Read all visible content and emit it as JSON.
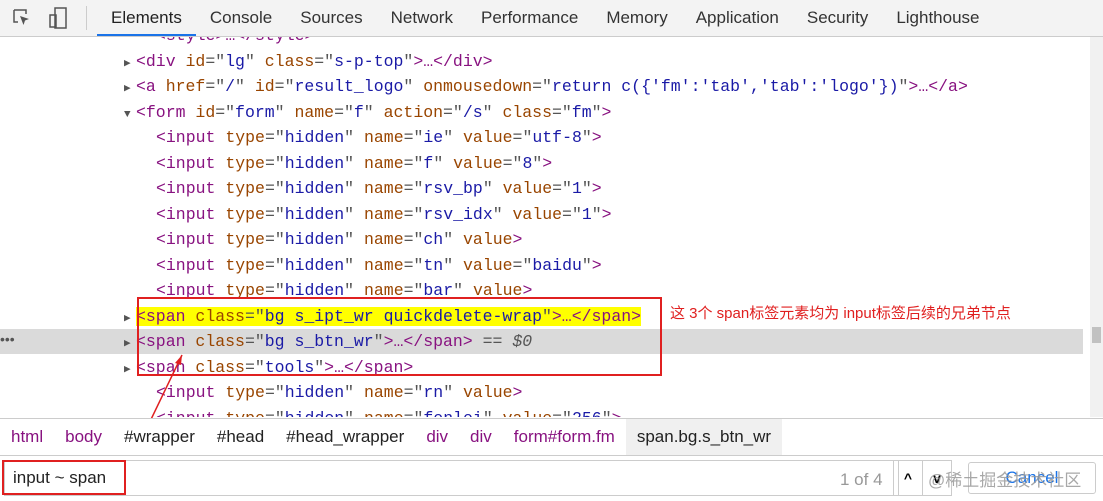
{
  "toolbar": {
    "tabs": [
      "Elements",
      "Console",
      "Sources",
      "Network",
      "Performance",
      "Memory",
      "Application",
      "Security",
      "Lighthouse"
    ],
    "active": "Elements"
  },
  "code_lines": [
    {
      "indent": 14,
      "tri": "",
      "tokens": [
        [
          "p",
          "<"
        ],
        [
          "t",
          "style"
        ],
        [
          "p",
          ">…</"
        ],
        [
          "t",
          "style"
        ],
        [
          "p",
          ">"
        ]
      ]
    },
    {
      "indent": 12,
      "tri": "▶",
      "tokens": [
        [
          "p",
          "<"
        ],
        [
          "t",
          "div "
        ],
        [
          "an",
          "id"
        ],
        [
          "eq",
          "=\""
        ],
        [
          "av",
          "lg"
        ],
        [
          "eq",
          "\" "
        ],
        [
          "an",
          "class"
        ],
        [
          "eq",
          "=\""
        ],
        [
          "av",
          "s-p-top"
        ],
        [
          "eq",
          "\""
        ],
        [
          "p",
          ">…</"
        ],
        [
          "t",
          "div"
        ],
        [
          "p",
          ">"
        ]
      ]
    },
    {
      "indent": 12,
      "tri": "▶",
      "tokens": [
        [
          "p",
          "<"
        ],
        [
          "t",
          "a "
        ],
        [
          "an",
          "href"
        ],
        [
          "eq",
          "=\""
        ],
        [
          "av",
          "/"
        ],
        [
          "eq",
          "\" "
        ],
        [
          "an",
          "id"
        ],
        [
          "eq",
          "=\""
        ],
        [
          "av",
          "result_logo"
        ],
        [
          "eq",
          "\" "
        ],
        [
          "an",
          "onmousedown"
        ],
        [
          "eq",
          "=\""
        ],
        [
          "av",
          "return c({'fm':'tab','tab':'logo'})"
        ],
        [
          "eq",
          "\""
        ],
        [
          "p",
          ">…</"
        ],
        [
          "t",
          "a"
        ],
        [
          "p",
          ">"
        ]
      ]
    },
    {
      "indent": 12,
      "tri": "▼",
      "tokens": [
        [
          "p",
          "<"
        ],
        [
          "t",
          "form "
        ],
        [
          "an",
          "id"
        ],
        [
          "eq",
          "=\""
        ],
        [
          "av",
          "form"
        ],
        [
          "eq",
          "\" "
        ],
        [
          "an",
          "name"
        ],
        [
          "eq",
          "=\""
        ],
        [
          "av",
          "f"
        ],
        [
          "eq",
          "\" "
        ],
        [
          "an",
          "action"
        ],
        [
          "eq",
          "=\""
        ],
        [
          "av",
          "/s"
        ],
        [
          "eq",
          "\" "
        ],
        [
          "an",
          "class"
        ],
        [
          "eq",
          "=\""
        ],
        [
          "av",
          "fm"
        ],
        [
          "eq",
          "\""
        ],
        [
          "p",
          ">"
        ]
      ]
    },
    {
      "indent": 14,
      "tri": "",
      "tokens": [
        [
          "p",
          "<"
        ],
        [
          "t",
          "input "
        ],
        [
          "an",
          "type"
        ],
        [
          "eq",
          "=\""
        ],
        [
          "av",
          "hidden"
        ],
        [
          "eq",
          "\" "
        ],
        [
          "an",
          "name"
        ],
        [
          "eq",
          "=\""
        ],
        [
          "av",
          "ie"
        ],
        [
          "eq",
          "\" "
        ],
        [
          "an",
          "value"
        ],
        [
          "eq",
          "=\""
        ],
        [
          "av",
          "utf-8"
        ],
        [
          "eq",
          "\""
        ],
        [
          "p",
          ">"
        ]
      ]
    },
    {
      "indent": 14,
      "tri": "",
      "tokens": [
        [
          "p",
          "<"
        ],
        [
          "t",
          "input "
        ],
        [
          "an",
          "type"
        ],
        [
          "eq",
          "=\""
        ],
        [
          "av",
          "hidden"
        ],
        [
          "eq",
          "\" "
        ],
        [
          "an",
          "name"
        ],
        [
          "eq",
          "=\""
        ],
        [
          "av",
          "f"
        ],
        [
          "eq",
          "\" "
        ],
        [
          "an",
          "value"
        ],
        [
          "eq",
          "=\""
        ],
        [
          "av",
          "8"
        ],
        [
          "eq",
          "\""
        ],
        [
          "p",
          ">"
        ]
      ]
    },
    {
      "indent": 14,
      "tri": "",
      "tokens": [
        [
          "p",
          "<"
        ],
        [
          "t",
          "input "
        ],
        [
          "an",
          "type"
        ],
        [
          "eq",
          "=\""
        ],
        [
          "av",
          "hidden"
        ],
        [
          "eq",
          "\" "
        ],
        [
          "an",
          "name"
        ],
        [
          "eq",
          "=\""
        ],
        [
          "av",
          "rsv_bp"
        ],
        [
          "eq",
          "\" "
        ],
        [
          "an",
          "value"
        ],
        [
          "eq",
          "=\""
        ],
        [
          "av",
          "1"
        ],
        [
          "eq",
          "\""
        ],
        [
          "p",
          ">"
        ]
      ]
    },
    {
      "indent": 14,
      "tri": "",
      "tokens": [
        [
          "p",
          "<"
        ],
        [
          "t",
          "input "
        ],
        [
          "an",
          "type"
        ],
        [
          "eq",
          "=\""
        ],
        [
          "av",
          "hidden"
        ],
        [
          "eq",
          "\" "
        ],
        [
          "an",
          "name"
        ],
        [
          "eq",
          "=\""
        ],
        [
          "av",
          "rsv_idx"
        ],
        [
          "eq",
          "\" "
        ],
        [
          "an",
          "value"
        ],
        [
          "eq",
          "=\""
        ],
        [
          "av",
          "1"
        ],
        [
          "eq",
          "\""
        ],
        [
          "p",
          ">"
        ]
      ]
    },
    {
      "indent": 14,
      "tri": "",
      "tokens": [
        [
          "p",
          "<"
        ],
        [
          "t",
          "input "
        ],
        [
          "an",
          "type"
        ],
        [
          "eq",
          "=\""
        ],
        [
          "av",
          "hidden"
        ],
        [
          "eq",
          "\" "
        ],
        [
          "an",
          "name"
        ],
        [
          "eq",
          "=\""
        ],
        [
          "av",
          "ch"
        ],
        [
          "eq",
          "\" "
        ],
        [
          "an",
          "value"
        ],
        [
          "p",
          ">"
        ]
      ]
    },
    {
      "indent": 14,
      "tri": "",
      "tokens": [
        [
          "p",
          "<"
        ],
        [
          "t",
          "input "
        ],
        [
          "an",
          "type"
        ],
        [
          "eq",
          "=\""
        ],
        [
          "av",
          "hidden"
        ],
        [
          "eq",
          "\" "
        ],
        [
          "an",
          "name"
        ],
        [
          "eq",
          "=\""
        ],
        [
          "av",
          "tn"
        ],
        [
          "eq",
          "\" "
        ],
        [
          "an",
          "value"
        ],
        [
          "eq",
          "=\""
        ],
        [
          "av",
          "baidu"
        ],
        [
          "eq",
          "\""
        ],
        [
          "p",
          ">"
        ]
      ]
    },
    {
      "indent": 14,
      "tri": "",
      "tokens": [
        [
          "p",
          "<"
        ],
        [
          "t",
          "input "
        ],
        [
          "an",
          "type"
        ],
        [
          "eq",
          "=\""
        ],
        [
          "av",
          "hidden"
        ],
        [
          "eq",
          "\" "
        ],
        [
          "an",
          "name"
        ],
        [
          "eq",
          "=\""
        ],
        [
          "av",
          "bar"
        ],
        [
          "eq",
          "\" "
        ],
        [
          "an",
          "value"
        ],
        [
          "p",
          ">"
        ]
      ]
    },
    {
      "indent": 12,
      "tri": "▶",
      "hl": true,
      "tokens": [
        [
          "p",
          "<"
        ],
        [
          "t",
          "span "
        ],
        [
          "an",
          "class"
        ],
        [
          "eq",
          "=\""
        ],
        [
          "av",
          "bg s_ipt_wr quickdelete-wrap"
        ],
        [
          "eq",
          "\""
        ],
        [
          "p",
          ">…</"
        ],
        [
          "t",
          "span"
        ],
        [
          "p",
          ">"
        ]
      ]
    },
    {
      "indent": 12,
      "tri": "▶",
      "sel": true,
      "tokens": [
        [
          "p",
          "<"
        ],
        [
          "t",
          "span "
        ],
        [
          "an",
          "class"
        ],
        [
          "eq",
          "=\""
        ],
        [
          "av",
          "bg s_btn_wr"
        ],
        [
          "eq",
          "\""
        ],
        [
          "p",
          ">…</"
        ],
        [
          "t",
          "span"
        ],
        [
          "p",
          "> "
        ],
        [
          "eq",
          "== "
        ],
        [
          "dl",
          "$0"
        ]
      ]
    },
    {
      "indent": 12,
      "tri": "▶",
      "tokens": [
        [
          "p",
          "<"
        ],
        [
          "t",
          "span "
        ],
        [
          "an",
          "class"
        ],
        [
          "eq",
          "=\""
        ],
        [
          "av",
          "tools"
        ],
        [
          "eq",
          "\""
        ],
        [
          "p",
          ">…</"
        ],
        [
          "t",
          "span"
        ],
        [
          "p",
          ">"
        ]
      ]
    },
    {
      "indent": 14,
      "tri": "",
      "tokens": [
        [
          "p",
          "<"
        ],
        [
          "t",
          "input "
        ],
        [
          "an",
          "type"
        ],
        [
          "eq",
          "=\""
        ],
        [
          "av",
          "hidden"
        ],
        [
          "eq",
          "\" "
        ],
        [
          "an",
          "name"
        ],
        [
          "eq",
          "=\""
        ],
        [
          "av",
          "rn"
        ],
        [
          "eq",
          "\" "
        ],
        [
          "an",
          "value"
        ],
        [
          "p",
          ">"
        ]
      ]
    },
    {
      "indent": 14,
      "tri": "",
      "tokens": [
        [
          "p",
          "<"
        ],
        [
          "t",
          "input "
        ],
        [
          "an",
          "type"
        ],
        [
          "eq",
          "=\""
        ],
        [
          "av",
          "hidden"
        ],
        [
          "eq",
          "\" "
        ],
        [
          "an",
          "name"
        ],
        [
          "eq",
          "=\""
        ],
        [
          "av",
          "fenlei"
        ],
        [
          "eq",
          "\" "
        ],
        [
          "an",
          "value"
        ],
        [
          "eq",
          "=\""
        ],
        [
          "av",
          "256"
        ],
        [
          "eq",
          "\""
        ],
        [
          "p",
          ">"
        ]
      ]
    }
  ],
  "breadcrumbs": [
    {
      "text": "html",
      "tag": true
    },
    {
      "text": "body",
      "tag": true
    },
    {
      "text": "#wrapper"
    },
    {
      "text": "#head"
    },
    {
      "text": "#head_wrapper"
    },
    {
      "text": "div",
      "tag": true
    },
    {
      "text": "div",
      "tag": true
    },
    {
      "text": "form#form.fm",
      "tag": true
    },
    {
      "text": "span.bg.s_btn_wr",
      "current": true
    }
  ],
  "search": {
    "value": "input ~ span",
    "count": "1 of 4",
    "up": "^",
    "down": "v",
    "cancel": "Cancel"
  },
  "annotation": "这 3个 span标签元素均为 input标签后续的兄弟节点",
  "watermark": "@稀土掘金技术社区",
  "dots": "•••"
}
